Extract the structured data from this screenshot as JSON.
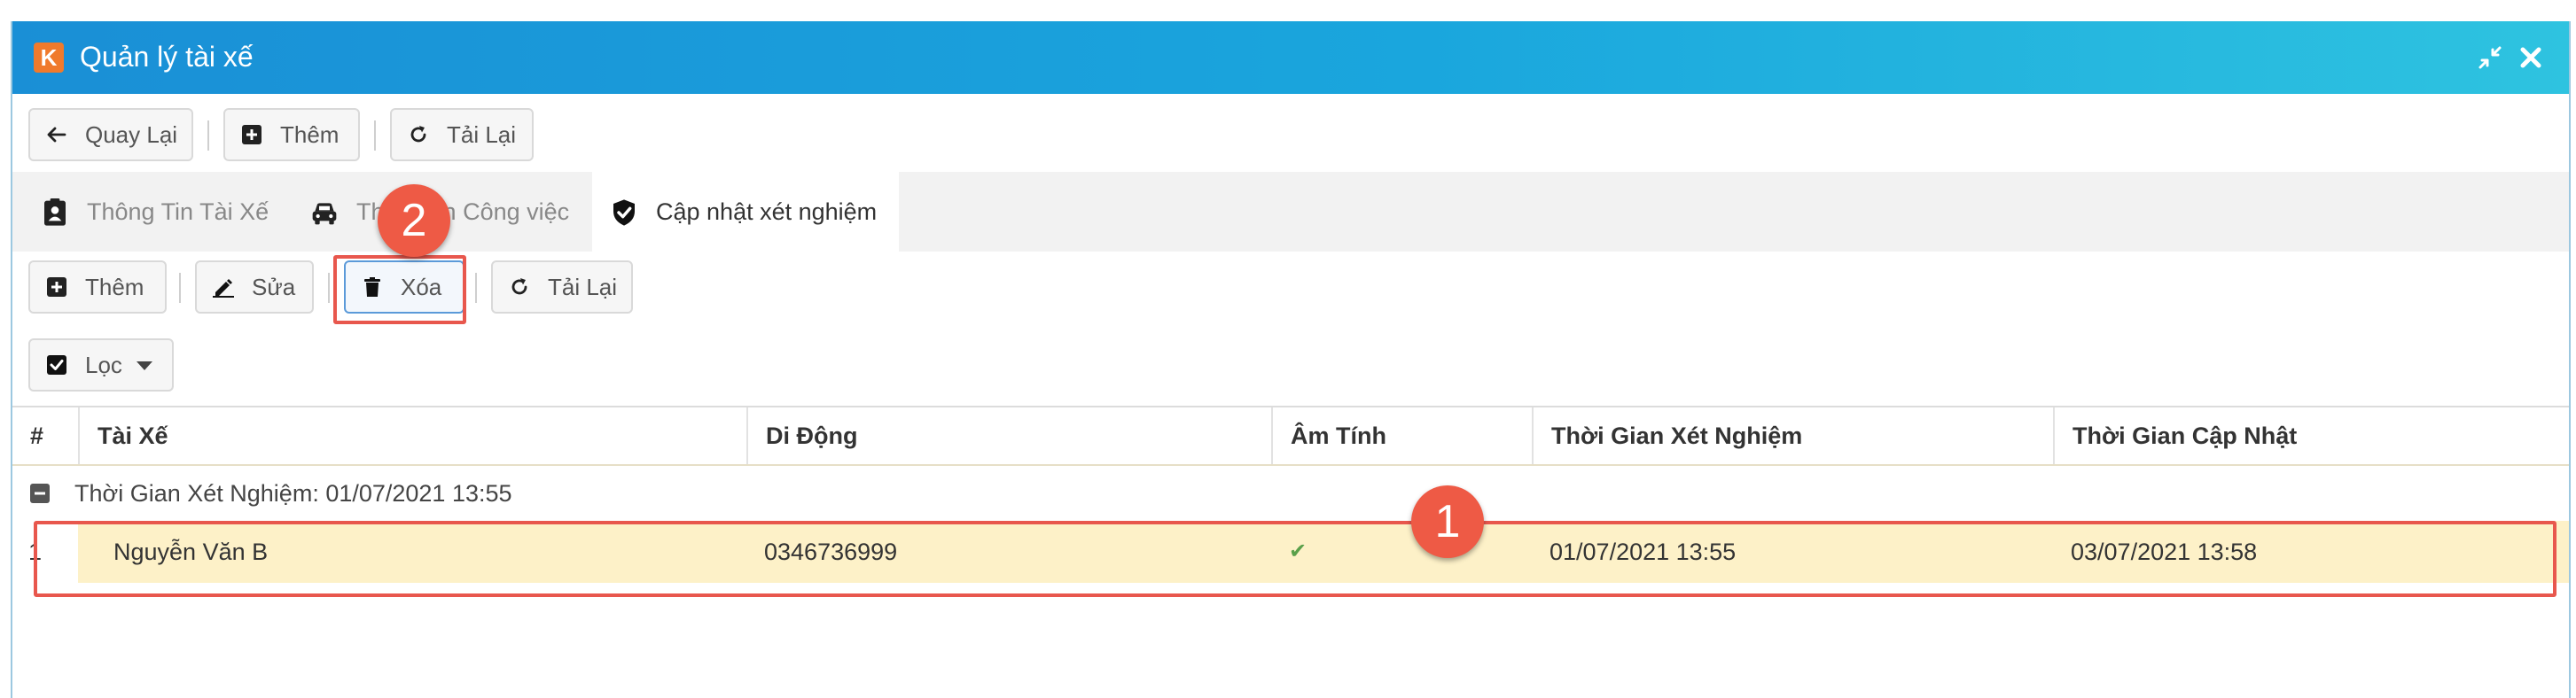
{
  "window": {
    "title": "Quản lý tài xế",
    "logo_letter": "K"
  },
  "toolbar": {
    "back_label": "Quay Lại",
    "add_label": "Thêm",
    "reload_label": "Tải Lại"
  },
  "tabs": [
    {
      "label": "Thông Tin Tài Xế",
      "icon": "contact-card-icon"
    },
    {
      "label": "Thông tin Công việc",
      "icon": "car-icon"
    },
    {
      "label": "Cập nhật xét nghiệm",
      "icon": "shield-check-icon"
    }
  ],
  "subtoolbar": {
    "add_label": "Thêm",
    "edit_label": "Sửa",
    "delete_label": "Xóa",
    "reload_label": "Tải Lại",
    "filter_label": "Lọc"
  },
  "grid": {
    "columns": [
      "#",
      "Tài Xế",
      "Di Động",
      "Âm Tính",
      "Thời Gian Xét Nghiệm",
      "Thời Gian Cập Nhật"
    ],
    "group_label": "Thời Gian Xét Nghiệm: 01/07/2021 13:55",
    "rows": [
      {
        "index": "1",
        "driver": "Nguyễn Văn B",
        "mobile": "0346736999",
        "negative": "✔",
        "test_time": "01/07/2021 13:55",
        "updated_time": "03/07/2021 13:58"
      }
    ]
  },
  "callouts": {
    "one": "1",
    "two": "2"
  },
  "colors": {
    "titlebar": "#1a8fd6",
    "highlight_row": "#fdf1c8",
    "callout": "#ee5a45",
    "check": "#5aa04a"
  }
}
